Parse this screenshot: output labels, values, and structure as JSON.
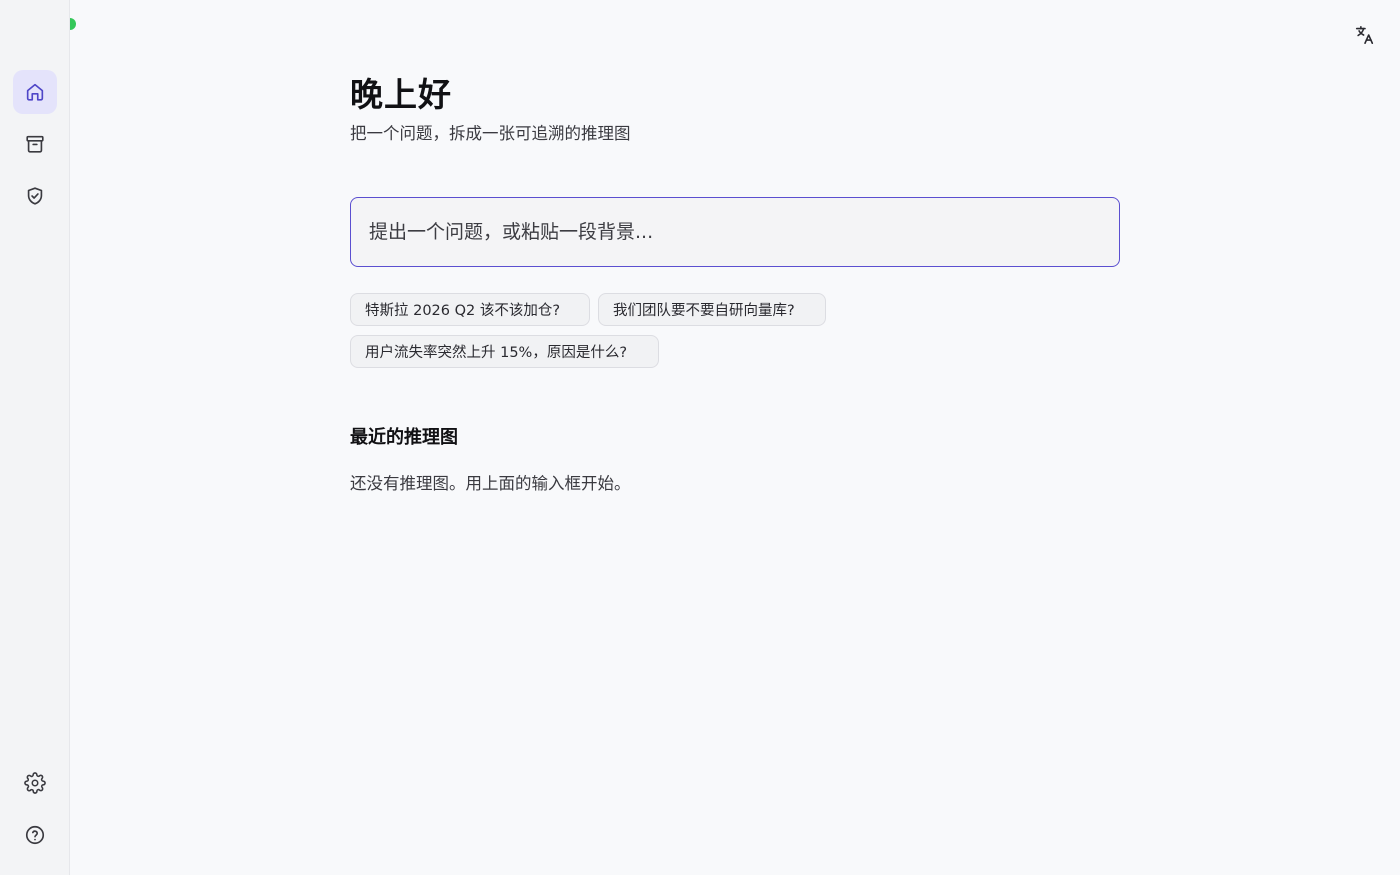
{
  "sidebar": {
    "items": [
      {
        "icon": "home-icon",
        "active": true
      },
      {
        "icon": "archive-icon",
        "active": false
      },
      {
        "icon": "shield-check-icon",
        "active": false
      }
    ],
    "footer": [
      {
        "icon": "gear-icon"
      },
      {
        "icon": "help-circle-icon"
      }
    ],
    "status_color": "#34c759"
  },
  "header": {
    "translate_icon": "translate-icon"
  },
  "main": {
    "greeting": "晚上好",
    "subtitle": "把一个问题，拆成一张可追溯的推理图",
    "ask": {
      "placeholder": "提出一个问题，或粘贴一段背景...",
      "value": ""
    },
    "suggestions": [
      "特斯拉 2026 Q2 该不该加仓?",
      "我们团队要不要自研向量库?",
      "用户流失率突然上升 15%，原因是什么?"
    ],
    "recent": {
      "title": "最近的推理图",
      "empty_text": "还没有推理图。用上面的输入框开始。"
    }
  },
  "colors": {
    "accent": "#5b4fd0",
    "active_nav_bg": "#e4e3fb",
    "background": "#f8f9fb"
  }
}
